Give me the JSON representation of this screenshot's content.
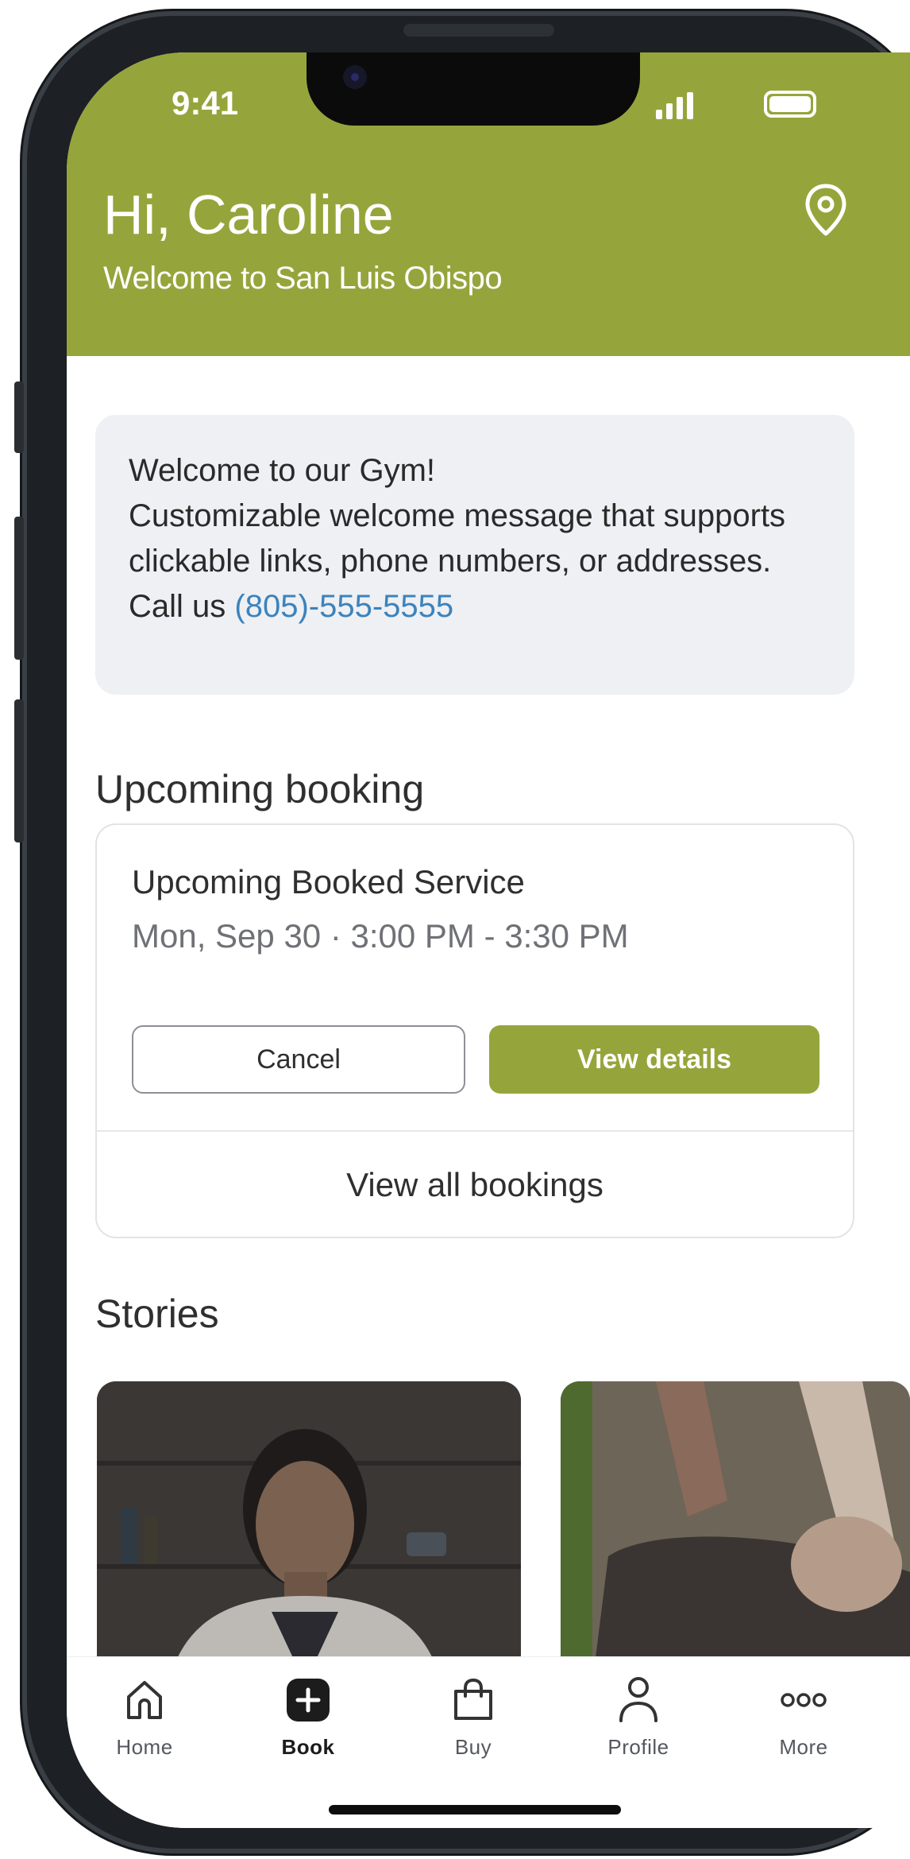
{
  "status_bar": {
    "time": "9:41"
  },
  "header": {
    "greeting": "Hi, Caroline",
    "subtitle": "Welcome to San Luis Obispo",
    "location_icon": "map-pin-icon",
    "background_color": "#96a53b"
  },
  "welcome_card": {
    "line1": "Welcome to our Gym!",
    "body": "Customizable welcome message that supports clickable links, phone numbers, or addresses. Call us",
    "phone": "(805)-555-5555",
    "link_color": "#3c83bc"
  },
  "upcoming": {
    "section_title": "Upcoming booking",
    "service_name": "Upcoming Booked Service",
    "service_time": "Mon, Sep 30 · 3:00 PM - 3:30 PM",
    "cancel_label": "Cancel",
    "details_label": "View details",
    "view_all_label": "View all bookings"
  },
  "stories": {
    "section_title": "Stories"
  },
  "bottom_nav": {
    "items": [
      {
        "label": "Home",
        "icon": "home-icon"
      },
      {
        "label": "Book",
        "icon": "plus-square-icon",
        "active": true
      },
      {
        "label": "Buy",
        "icon": "shopping-bag-icon"
      },
      {
        "label": "Profile",
        "icon": "person-icon"
      },
      {
        "label": "More",
        "icon": "more-dots-icon"
      }
    ]
  },
  "accent_color": "#96a53b"
}
